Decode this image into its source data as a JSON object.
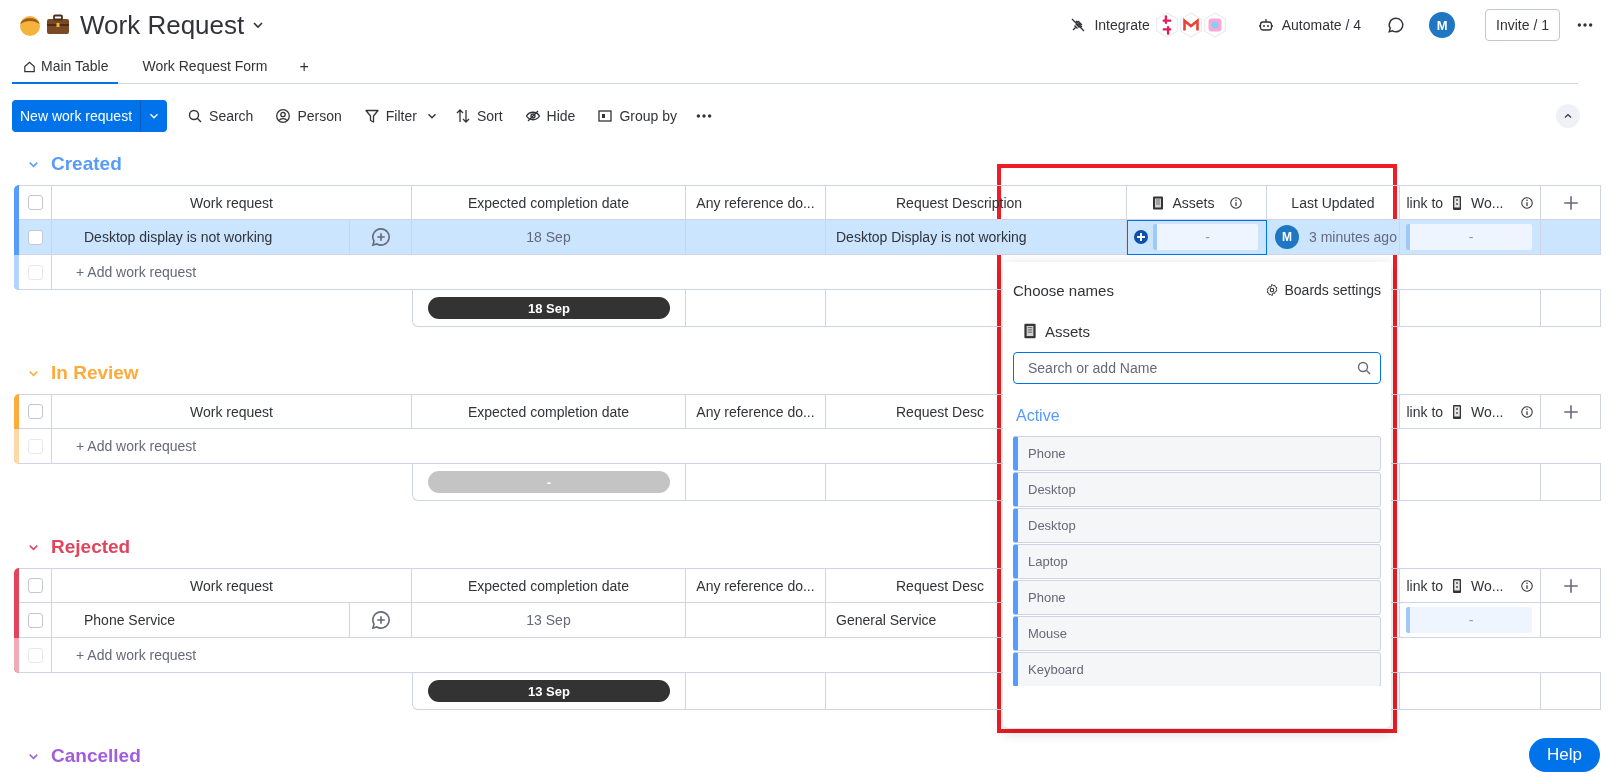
{
  "board": {
    "title": "Work Request"
  },
  "tabs": [
    {
      "label": "Main Table",
      "selected": true
    },
    {
      "label": "Work Request Form",
      "selected": false
    }
  ],
  "add_tab": "+",
  "header_actions": {
    "integrate": "Integrate",
    "automate": "Automate / 4",
    "avatar": "M",
    "invite": "Invite / 1"
  },
  "toolbar": {
    "new_button": "New work request",
    "items": [
      {
        "kind": "search",
        "label": "Search"
      },
      {
        "kind": "person",
        "label": "Person"
      },
      {
        "kind": "filter",
        "label": "Filter"
      },
      {
        "kind": "sort",
        "label": "Sort"
      },
      {
        "kind": "hide",
        "label": "Hide"
      },
      {
        "kind": "group",
        "label": "Group by"
      }
    ]
  },
  "groups": [
    {
      "title": "Created",
      "color": "#579bfc",
      "all_checked": false,
      "columns": [
        {
          "kind": "name",
          "label": "Work request"
        },
        {
          "kind": "date",
          "label": "Expected completion date"
        },
        {
          "kind": "text",
          "label": "Any reference do..."
        },
        {
          "kind": "desc",
          "label": "Request Description"
        },
        {
          "kind": "assets",
          "label": "Assets"
        },
        {
          "kind": "text",
          "label": "Last Updated"
        },
        {
          "kind": "link",
          "label": "link to",
          "suffix": "Wo..."
        }
      ],
      "rows": [
        {
          "selected": true,
          "checked": false,
          "cells": [
            {
              "kind": "name",
              "text": "Desktop display is not working"
            },
            {
              "kind": "date",
              "text": "18 Sep"
            },
            {
              "kind": "empty"
            },
            {
              "kind": "text",
              "text": "Desktop Display is not working"
            },
            {
              "kind": "assets",
              "text": "-",
              "focused": true
            },
            {
              "kind": "person",
              "avatar": "M",
              "text": "3 minutes ago"
            },
            {
              "kind": "link",
              "text": "-"
            }
          ]
        }
      ],
      "add_label": "+ Add work request",
      "summary": {
        "text": "18 Sep",
        "has_dates": true
      }
    },
    {
      "title": "In Review",
      "color": "#fdab3d",
      "all_checked": false,
      "columns": [
        {
          "kind": "name",
          "label": "Work request"
        },
        {
          "kind": "date",
          "label": "Expected completion date"
        },
        {
          "kind": "text",
          "label": "Any reference do..."
        },
        {
          "kind": "desc",
          "label": "Request Desc"
        },
        {
          "kind": "covered"
        },
        {
          "kind": "covered"
        },
        {
          "kind": "link",
          "label": "link to",
          "suffix": "Wo..."
        }
      ],
      "add_label": "+ Add work request",
      "summary": {
        "text": "-",
        "has_dates": false
      }
    },
    {
      "title": "Rejected",
      "color": "#e2445c",
      "all_checked": false,
      "columns": [
        {
          "kind": "name",
          "label": "Work request"
        },
        {
          "kind": "date",
          "label": "Expected completion date"
        },
        {
          "kind": "text",
          "label": "Any reference do..."
        },
        {
          "kind": "desc",
          "label": "Request Desc"
        },
        {
          "kind": "covered"
        },
        {
          "kind": "covered"
        },
        {
          "kind": "link",
          "label": "link to",
          "suffix": "Wo..."
        }
      ],
      "rows": [
        {
          "selected": false,
          "checked": false,
          "cells": [
            {
              "kind": "name",
              "text": "Phone Service"
            },
            {
              "kind": "date",
              "text": "13 Sep"
            },
            {
              "kind": "empty"
            },
            {
              "kind": "text",
              "text": "General Service"
            },
            {
              "kind": "covered"
            },
            {
              "kind": "covered"
            },
            {
              "kind": "link",
              "text": "-"
            }
          ]
        }
      ],
      "add_label": "+ Add work request",
      "summary": {
        "text": "13 Sep",
        "has_dates": true
      }
    },
    {
      "title": "Cancelled",
      "color": "#a25ddc"
    }
  ],
  "popup": {
    "title": "Choose names",
    "settings": "Boards settings",
    "board": "Assets",
    "search_placeholder": "Search or add Name",
    "section": "Active",
    "items": [
      "Phone",
      "Desktop",
      "Desktop",
      "Laptop",
      "Phone",
      "Mouse",
      "Keyboard"
    ]
  },
  "help": "Help"
}
